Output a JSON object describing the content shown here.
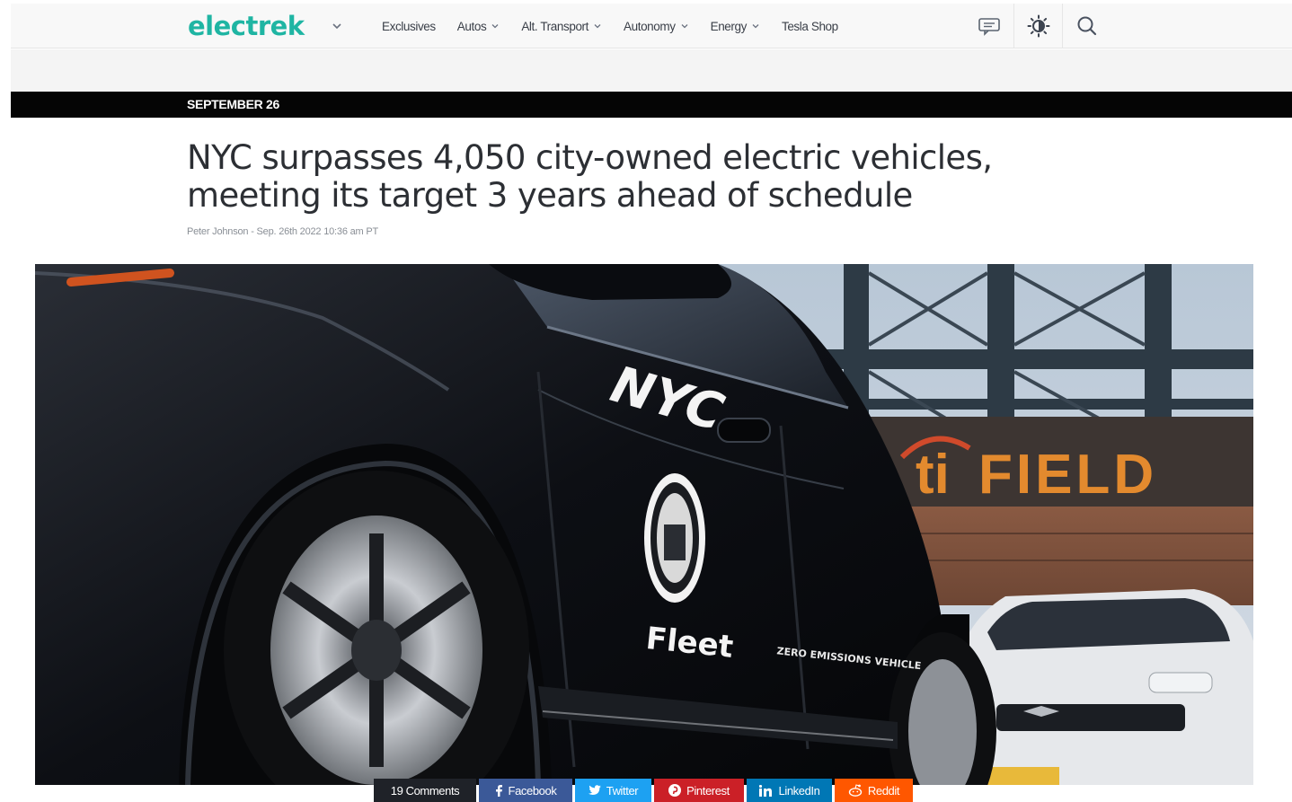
{
  "site": {
    "logo": "electrek",
    "nav": [
      {
        "label": "Exclusives",
        "has_dropdown": false
      },
      {
        "label": "Autos",
        "has_dropdown": true
      },
      {
        "label": "Alt. Transport",
        "has_dropdown": true
      },
      {
        "label": "Autonomy",
        "has_dropdown": true
      },
      {
        "label": "Energy",
        "has_dropdown": true
      },
      {
        "label": "Tesla Shop",
        "has_dropdown": false
      }
    ],
    "tools": [
      "comments-icon",
      "brightness-icon",
      "search-icon"
    ],
    "colors": {
      "brand": "#1fb5a3",
      "date_bar": "#050505"
    }
  },
  "article": {
    "date_label": "SEPTEMBER 26",
    "title": "NYC surpasses 4,050 city-owned electric vehicles, meeting its target 3 years ahead of schedule",
    "author": "Peter Johnson",
    "separator": " - ",
    "published": "Sep. 26th 2022 10:36 am PT"
  },
  "hero": {
    "door_text_top": "NYC",
    "door_text_fleet": "Fleet",
    "door_text_zero": "ZERO EMISSIONS VEHICLE",
    "sign_left": "ti",
    "sign_right": "FIELD"
  },
  "share": {
    "comments": "19 Comments",
    "buttons": [
      {
        "label": "Facebook",
        "icon": "facebook-icon",
        "color": "#3b5998"
      },
      {
        "label": "Twitter",
        "icon": "twitter-icon",
        "color": "#1da1f2"
      },
      {
        "label": "Pinterest",
        "icon": "pinterest-icon",
        "color": "#cb2027"
      },
      {
        "label": "LinkedIn",
        "icon": "linkedin-icon",
        "color": "#0077b5"
      },
      {
        "label": "Reddit",
        "icon": "reddit-icon",
        "color": "#ff5700"
      }
    ]
  }
}
